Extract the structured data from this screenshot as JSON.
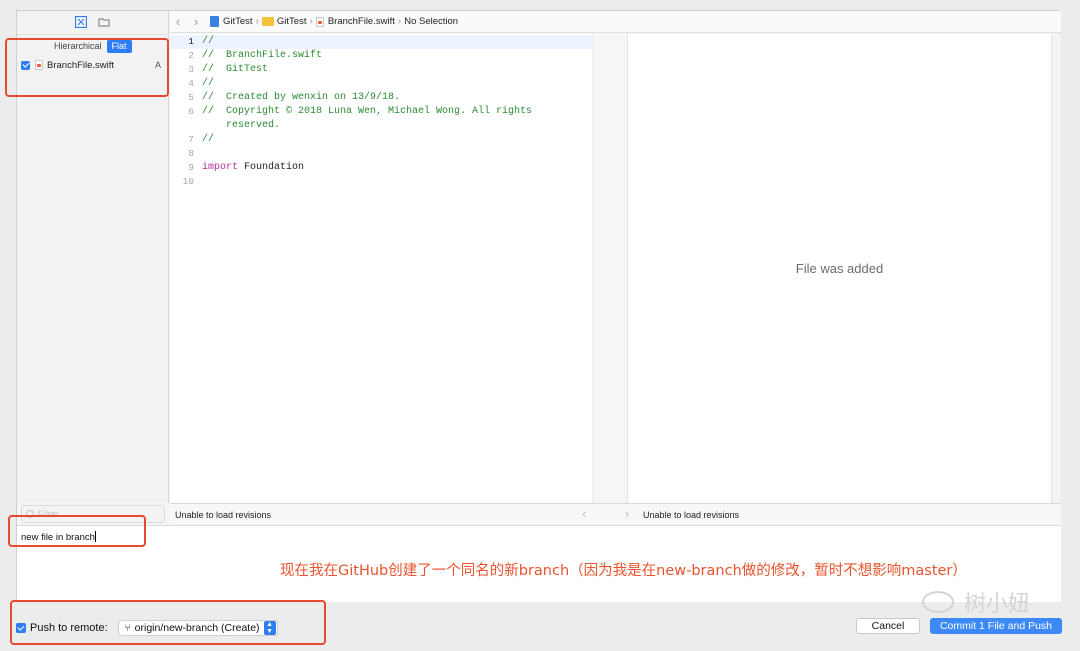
{
  "navigator": {
    "segment_hierarchical": "Hierarchical",
    "segment_flat": "Flat",
    "files": [
      {
        "name": "BranchFile.swift",
        "status": "A",
        "checked": true
      }
    ],
    "filter_placeholder": "Filter",
    "icons": [
      "changes-icon",
      "folder-icon"
    ]
  },
  "jump_bar": {
    "project": "GitTest",
    "group": "GitTest",
    "file": "BranchFile.swift",
    "selection": "No Selection"
  },
  "editor": {
    "line_numbers": [
      "1",
      "2",
      "3",
      "4",
      "5",
      "6",
      "",
      "7",
      "8",
      "9",
      "10"
    ],
    "lines": {
      "l1": "//",
      "l2": "//  BranchFile.swift",
      "l3": "//  GitTest",
      "l4": "//",
      "l5": "//  Created by wenxin on 13/9/18.",
      "l6a": "//  Copyright © 2018 Luna Wen, Michael Wong. All rights",
      "l6b": "    reserved.",
      "l7": "//",
      "l8": "",
      "l9_kw": "import",
      "l9_rest": " Foundation",
      "l10": ""
    }
  },
  "comparison": {
    "message": "File was added"
  },
  "revisions": {
    "left": "Unable to load revisions",
    "right": "Unable to load revisions"
  },
  "commit_message": {
    "value": "new file in branch"
  },
  "annotation": "现在我在GitHub创建了一个同名的新branch（因为我是在new-branch做的修改，暂时不想影响master）",
  "footer": {
    "push_label": "Push to remote:",
    "push_checked": true,
    "remote_branch": "origin/new-branch (Create)",
    "cancel_label": "Cancel",
    "commit_label": "Commit 1 File and Push",
    "watermark": "树小妞"
  },
  "colors": {
    "accent": "#2f7df6",
    "annotation_red": "#e64a2e",
    "comment_green": "#2d8a34",
    "keyword_purple": "#b72d9f"
  }
}
